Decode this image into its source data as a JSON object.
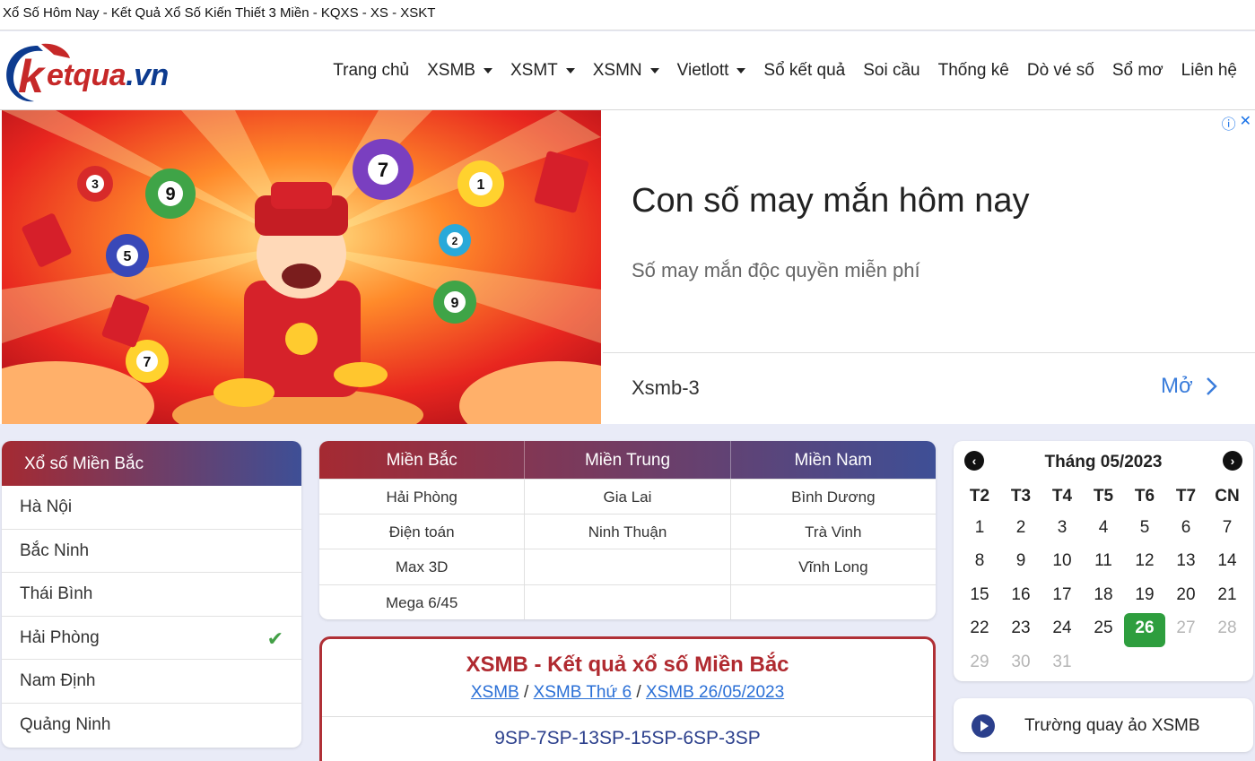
{
  "window": {
    "title": "Xổ Số Hôm Nay - Kết Quả Xổ Số Kiến Thiết 3 Miền - KQXS - XS - XSKT"
  },
  "logo": {
    "text_main": "etqua",
    "text_domain": ".vn",
    "letter": "k"
  },
  "nav": {
    "items": [
      "Trang chủ",
      "XSMB",
      "XSMT",
      "XSMN",
      "Vietlott",
      "Sổ kết quả",
      "Soi cầu",
      "Thống kê",
      "Dò vé số",
      "Sổ mơ",
      "Liên hệ"
    ],
    "has_dropdown": [
      false,
      true,
      true,
      true,
      true,
      false,
      false,
      false,
      false,
      false,
      false
    ]
  },
  "ad": {
    "title": "Con số may mắn hôm nay",
    "subtitle": "Số may mắn độc quyền miễn phí",
    "footer": "Xsmb-3",
    "open_label": "Mở",
    "ball_numbers": [
      "9",
      "7",
      "3",
      "5",
      "2",
      "9",
      "1",
      "7"
    ]
  },
  "sidebar": {
    "heading": "Xổ số Miền Bắc",
    "items": [
      "Hà Nội",
      "Bắc Ninh",
      "Thái Bình",
      "Hải Phòng",
      "Nam Định",
      "Quảng Ninh"
    ],
    "checked_item": "Hải Phòng"
  },
  "regions": {
    "headers": [
      "Miền Bắc",
      "Miền Trung",
      "Miền Nam"
    ],
    "rows": [
      [
        "Hải Phòng",
        "Gia Lai",
        "Bình Dương"
      ],
      [
        "Điện toán",
        "Ninh Thuận",
        "Trà Vinh"
      ],
      [
        "Max 3D",
        "",
        "Vĩnh Long"
      ],
      [
        "Mega 6/45",
        "",
        ""
      ]
    ]
  },
  "result": {
    "title": "XSMB - Kết quả xổ số Miền Bắc",
    "crumbs": [
      "XSMB",
      "XSMB Thứ 6",
      "XSMB 26/05/2023"
    ],
    "separator": " / ",
    "codes": "9SP-7SP-13SP-15SP-6SP-3SP"
  },
  "calendar": {
    "month_label": "Tháng 05/2023",
    "weekdays": [
      "T2",
      "T3",
      "T4",
      "T5",
      "T6",
      "T7",
      "CN"
    ],
    "days": [
      "1",
      "2",
      "3",
      "4",
      "5",
      "6",
      "7",
      "8",
      "9",
      "10",
      "11",
      "12",
      "13",
      "14",
      "15",
      "16",
      "17",
      "18",
      "19",
      "20",
      "21",
      "22",
      "23",
      "24",
      "25",
      "26",
      "27",
      "28",
      "29",
      "30",
      "31"
    ],
    "selected_day": "26",
    "muted_from": 27,
    "prev_icon": "arrow-left-icon",
    "next_icon": "arrow-right-icon"
  },
  "live": {
    "label": "Trường quay ảo XSMB",
    "icon": "play-icon"
  },
  "colors": {
    "brand_red": "#b02a30",
    "brand_blue": "#3e4f96",
    "today_green": "#2e9e3e",
    "link_blue": "#2a6fd6"
  }
}
